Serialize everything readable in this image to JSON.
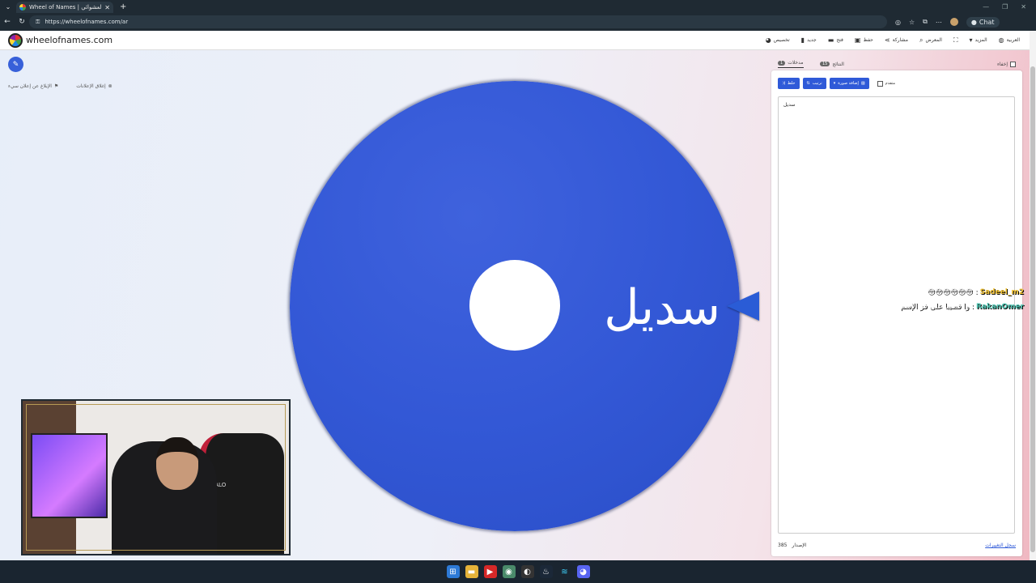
{
  "browser": {
    "tab_title": "Wheel of Names | الاسم العشوائي",
    "url": "https://wheelofnames.com/ar",
    "chat_label": "Chat"
  },
  "header": {
    "site_name": "wheelofnames.com",
    "menu": {
      "customize": "تخصيص",
      "new": "جديد",
      "open": "فتح",
      "save": "حفظ",
      "share": "مشاركة",
      "gallery": "المعرض",
      "more": "المزيد",
      "language": "العربية"
    }
  },
  "stage": {
    "report_ad": "الإبلاغ عن إعلان سيء",
    "close_ads": "إغلاق الإعلانات"
  },
  "wheel": {
    "segments": [
      "سديل"
    ],
    "color": "#3358d6"
  },
  "panel": {
    "tab_entries": "مدخلات",
    "tab_entries_count": "1",
    "tab_results": "النتائج",
    "tab_results_count": "15",
    "hide_label": "إخفاء",
    "shuffle_label": "خلط",
    "sort_label": "ترتيب",
    "add_image_label": "إضافة صورة",
    "advanced_label": "متقدم",
    "entries_text": "سديل",
    "version_label": "الإصدار",
    "version_number": "385",
    "changelog_label": "سجل التغييرات"
  },
  "chat": [
    {
      "name": "Sadeel_m2",
      "message": "😳😳😳😳😳😳"
    },
    {
      "name": "RakanOmer",
      "message": "وا قصيبا على فز الإسم"
    }
  ],
  "webcam": {
    "chair_brand": "HALO"
  }
}
